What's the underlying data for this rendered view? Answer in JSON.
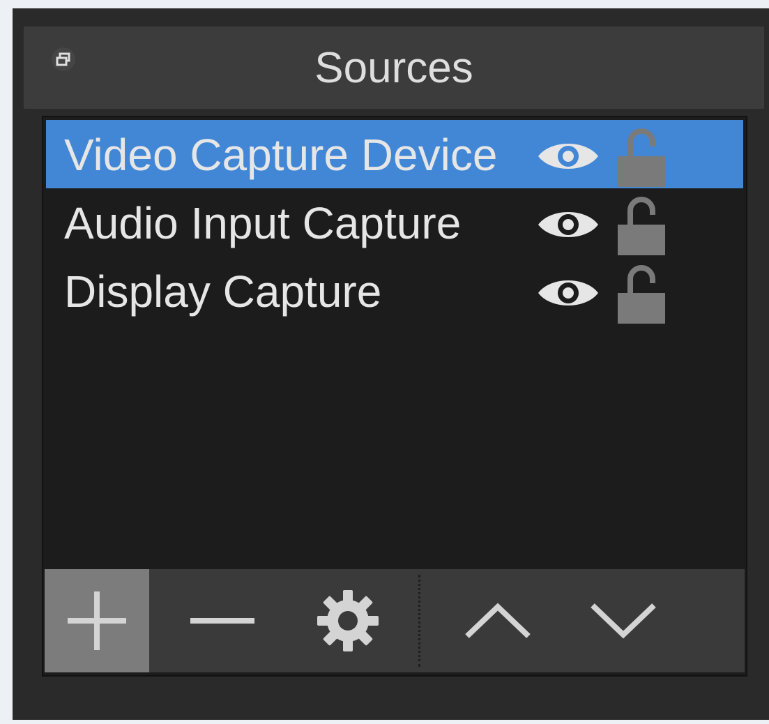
{
  "dock": {
    "title": "Sources",
    "float_icon": "float-window-icon"
  },
  "sources": [
    {
      "label": "Video Capture Device",
      "selected": true,
      "visible": true,
      "locked": false
    },
    {
      "label": "Audio Input Capture",
      "selected": false,
      "visible": true,
      "locked": false
    },
    {
      "label": "Display Capture",
      "selected": false,
      "visible": true,
      "locked": false
    }
  ],
  "toolbar": {
    "buttons": [
      {
        "name": "add",
        "icon": "plus-icon"
      },
      {
        "name": "remove",
        "icon": "minus-icon"
      },
      {
        "name": "properties",
        "icon": "gear-icon"
      },
      {
        "name": "move-up",
        "icon": "chevron-up-icon"
      },
      {
        "name": "move-down",
        "icon": "chevron-down-icon"
      }
    ]
  },
  "colors": {
    "selection": "#4287d6",
    "list_background": "#1c1c1c",
    "titlebar": "#3c3c3c",
    "toolbar": "#3a3a3a",
    "active_button": "#7c7c7c",
    "text": "#e6e6e6"
  }
}
